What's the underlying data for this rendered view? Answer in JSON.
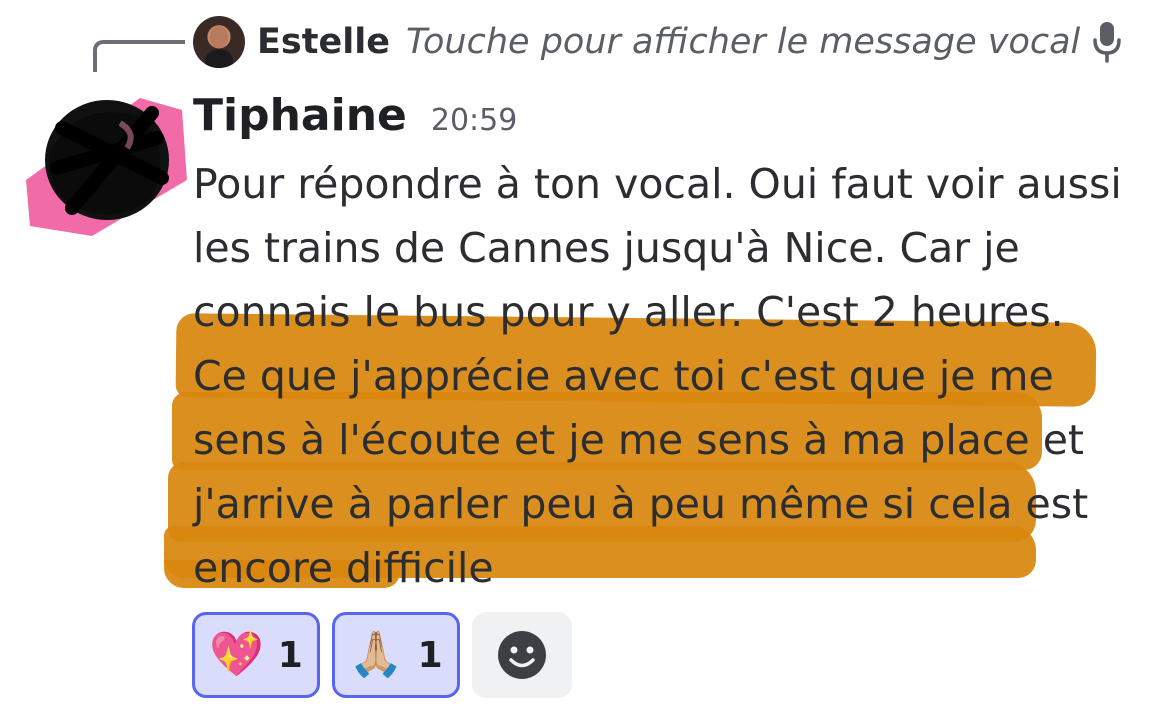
{
  "reply": {
    "author": "Estelle",
    "preview": "Touche pour afficher le message vocal",
    "icon": "microphone-icon"
  },
  "message": {
    "author": "Tiphaine",
    "timestamp": "20:59",
    "text": "Pour répondre à ton vocal. Oui faut voir aussi les trains de Cannes jusqu'à Nice. Car je connais le bus pour y aller. C'est 2 heures. Ce que j'apprécie avec toi c'est que je me sens à l'écoute et je me sens à ma place et j'arrive à parler peu à peu même si cela est encore difficile",
    "highlight_color": "#d8860d"
  },
  "reactions": [
    {
      "emoji": "💖",
      "name": "sparkling-heart",
      "count": "1"
    },
    {
      "emoji": "🙏🏼",
      "name": "folded-hands",
      "count": "1"
    }
  ],
  "add_reaction_icon": "smiley-icon",
  "colors": {
    "reaction_active_bg": "#d9dcfb",
    "reaction_active_border": "#5865f2",
    "avatar_scribble_pink": "#f06ba8"
  }
}
